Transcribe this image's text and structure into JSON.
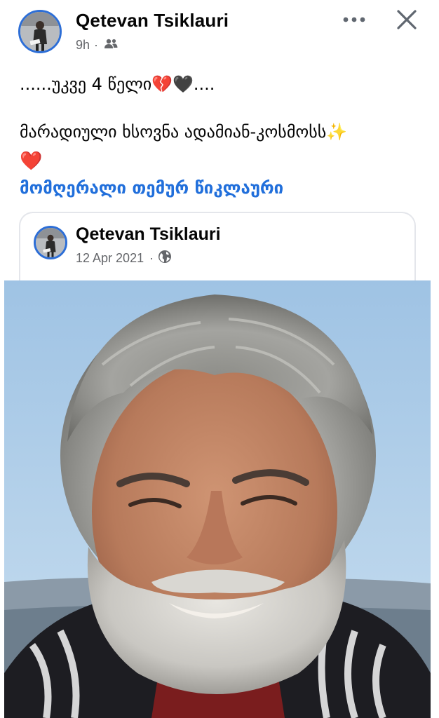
{
  "post": {
    "author": "Qetevan Tsiklauri",
    "time": "9h",
    "separator": "·",
    "audience_icon": "friends-icon",
    "text_line1": "......უკვე 4 წელი💔🖤....",
    "text_line2": "მარადიული ხსოვნა ადამიან-კოსმოსს✨",
    "text_line3": "❤️",
    "hashtag": "მომღერალი თემურ წიკლაური"
  },
  "header": {
    "more_icon": "more-horizontal-icon",
    "close_icon": "close-icon"
  },
  "shared": {
    "author": "Qetevan Tsiklauri",
    "date": "12 Apr 2021",
    "separator": "·",
    "audience_icon": "globe-icon"
  },
  "colors": {
    "link": "#216fdb",
    "avatar_ring": "#2d6ed6",
    "meta": "#65676b"
  }
}
